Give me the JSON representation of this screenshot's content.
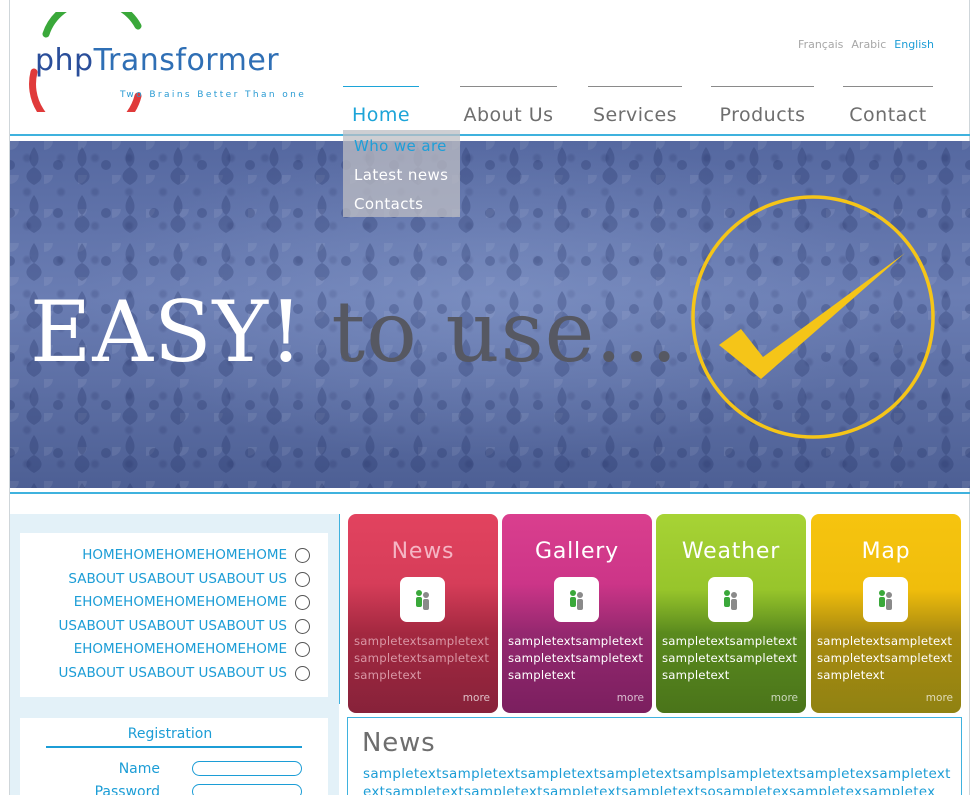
{
  "logo": {
    "text_php": "php",
    "text_transformer": "Transformer",
    "tagline": "Two Brains Better Than one"
  },
  "languages": [
    {
      "label": "Français",
      "active": false
    },
    {
      "label": "Arabic",
      "active": false
    },
    {
      "label": "English",
      "active": true
    }
  ],
  "nav": [
    {
      "label": "Home"
    },
    {
      "label": "About Us"
    },
    {
      "label": "Services"
    },
    {
      "label": "Products"
    },
    {
      "label": "Contact"
    }
  ],
  "dropdown": [
    "Who we are",
    "Latest news",
    "Contacts"
  ],
  "hero": {
    "headline_strong": "EASY!",
    "headline_rest": " to use..."
  },
  "sidebar_links": [
    "HOMEHOMEHOMEHOMEHOME",
    "SABOUT USABOUT USABOUT US",
    "EHOMEHOMEHOMEHOMEHOME",
    "USABOUT USABOUT USABOUT US",
    "EHOMEHOMEHOMEHOMEHOME",
    "USABOUT USABOUT USABOUT US"
  ],
  "registration": {
    "title": "Registration",
    "name_label": "Name",
    "password_label": "Password"
  },
  "tiles": [
    {
      "title": "News",
      "text": "sampletextsampletext sampletextsampletext sampletext",
      "more": "more"
    },
    {
      "title": "Gallery",
      "text": "sampletextsampletext sampletextsampletext sampletext",
      "more": "more"
    },
    {
      "title": "Weather",
      "text": "sampletextsampletext sampletextsampletext sampletext",
      "more": "more"
    },
    {
      "title": "Map",
      "text": "sampletextsampletext sampletextsampletext sampletext",
      "more": "more"
    }
  ],
  "news": {
    "heading": "News",
    "body": "sampletextsampletextsampletextsampletextsamplsampletextsampletexsampletextextsampletextsampletextsampletextsampletextsosampletexsampletexsampletex"
  },
  "colors": {
    "accent": "#1c9dd6",
    "rule": "#3fb2de",
    "check": "#f5c518"
  }
}
